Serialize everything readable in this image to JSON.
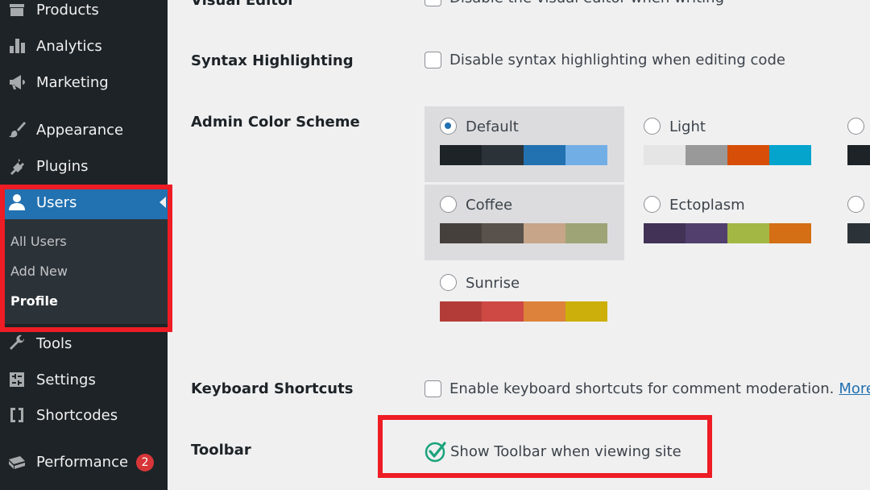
{
  "sidebar": {
    "items": [
      {
        "key": "products",
        "label": "Products",
        "icon": "products-icon"
      },
      {
        "key": "analytics",
        "label": "Analytics",
        "icon": "analytics-icon"
      },
      {
        "key": "marketing",
        "label": "Marketing",
        "icon": "megaphone-icon"
      },
      {
        "key": "appearance",
        "label": "Appearance",
        "icon": "paintbrush-icon"
      },
      {
        "key": "plugins",
        "label": "Plugins",
        "icon": "plug-icon"
      },
      {
        "key": "users",
        "label": "Users",
        "icon": "user-icon",
        "active": true
      },
      {
        "key": "tools",
        "label": "Tools",
        "icon": "wrench-icon"
      },
      {
        "key": "settings",
        "label": "Settings",
        "icon": "sliders-icon"
      },
      {
        "key": "shortcodes",
        "label": "Shortcodes",
        "icon": "brackets-icon"
      },
      {
        "key": "performance",
        "label": "Performance",
        "icon": "performance-icon",
        "badge": "2"
      }
    ],
    "submenu": [
      {
        "label": "All Users"
      },
      {
        "label": "Add New"
      },
      {
        "label": "Profile",
        "current": true
      }
    ]
  },
  "settings": {
    "visual_editor": {
      "label": "Visual Editor",
      "option": "Disable the visual editor when writing",
      "checked": false
    },
    "syntax": {
      "label": "Syntax Highlighting",
      "option": "Disable syntax highlighting when editing code",
      "checked": false
    },
    "color_scheme": {
      "label": "Admin Color Scheme",
      "schemes": [
        {
          "name": "Default",
          "selected": true,
          "colors": [
            "#1d2327",
            "#2c3338",
            "#2271b1",
            "#72aee6"
          ]
        },
        {
          "name": "Light",
          "selected": false,
          "colors": [
            "#e5e5e5",
            "#999999",
            "#d64e07",
            "#04a4cc"
          ]
        },
        {
          "name": "Coffee",
          "selected": false,
          "colors": [
            "#46403c",
            "#59524c",
            "#c7a589",
            "#9ea476"
          ]
        },
        {
          "name": "Ectoplasm",
          "selected": false,
          "colors": [
            "#413256",
            "#523f6d",
            "#a3b745",
            "#d46f15"
          ]
        },
        {
          "name": "Sunrise",
          "selected": false,
          "colors": [
            "#b43c38",
            "#cf4944",
            "#dd823b",
            "#ccaf0b"
          ]
        }
      ]
    },
    "keyboard": {
      "label": "Keyboard Shortcuts",
      "option": "Enable keyboard shortcuts for comment moderation.",
      "link": "More infor",
      "checked": false
    },
    "toolbar": {
      "label": "Toolbar",
      "option": "Show Toolbar when viewing site",
      "checked": true
    }
  },
  "colors": {
    "highlight": "#ee1c24",
    "accent": "#2271b1",
    "check": "#1aa37a"
  }
}
